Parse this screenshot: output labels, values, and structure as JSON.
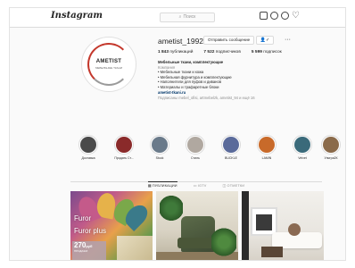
{
  "nav": {
    "logo": "Instagram",
    "search_placeholder": "Поиск",
    "icons": [
      "home-icon",
      "direct-icon",
      "explore-icon",
      "heart-icon"
    ]
  },
  "profile": {
    "avatar_brand": "AMETIST",
    "avatar_sub": "МЕБЕЛЬНЫЕ ТКАНИ",
    "username": "ametist_1992",
    "message_button": "Отправить сообщение",
    "follow_icon": "person-check-icon",
    "more": "···",
    "stats": [
      {
        "value": "1 843",
        "label": "публикаций"
      },
      {
        "value": "7 522",
        "label": "подписчиков"
      },
      {
        "value": "5 599",
        "label": "подписок"
      }
    ],
    "bio": {
      "name": "Мебельные ткани, комплектующие",
      "category": "Компания",
      "lines": [
        "• Мебельные ткани и кожа",
        "• Мебельная фурнитура и комплектующие",
        "• Наполнители для пуфов и диванов",
        "• Материалы и трафаретные блоки"
      ],
      "link": "ametist-tkani.ru",
      "followed_by": "Подписаны mebel_ofisi, artmebelzk, ametist_94 и ещё 16"
    }
  },
  "highlights": [
    {
      "label": "Доставка",
      "color": "#4a4a4a"
    },
    {
      "label": "Продать Ст...",
      "color": "#8a2a2a"
    },
    {
      "label": "Stock",
      "color": "#6a7a8a"
    },
    {
      "label": "Стиль",
      "color": "#b0a8a0"
    },
    {
      "label": "BUCKLE",
      "color": "#5a6a9a"
    },
    {
      "label": "LAMIN",
      "color": "#c86a2a"
    },
    {
      "label": "Velvet",
      "color": "#3a6a7a"
    },
    {
      "label": "Ультра2К",
      "color": "#8a6a4a"
    }
  ],
  "tabs": [
    {
      "label": "ПУБЛИКАЦИИ",
      "active": true
    },
    {
      "label": "IGTV",
      "active": false
    },
    {
      "label": "ОТМЕТКИ",
      "active": false
    }
  ],
  "posts": [
    {
      "overlay_lines": [
        "Furor",
        "Furor plus"
      ],
      "badge_big": "270",
      "badge_unit": "руб",
      "badge_small": "ПРОДАЖИ"
    },
    {
      "alt": "armchair"
    },
    {
      "alt": "living room"
    }
  ]
}
